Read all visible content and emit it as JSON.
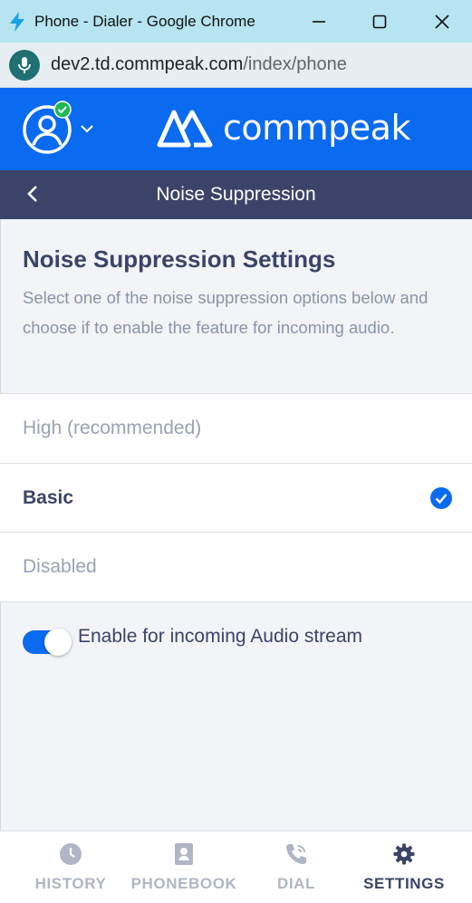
{
  "window": {
    "title": "Phone - Dialer - Google Chrome",
    "url_domain": "dev2.td.commpeak.com",
    "url_path": "/index/phone"
  },
  "header": {
    "logo_text": "commpeak",
    "brand_color": "#0a6af0",
    "status": "online"
  },
  "subheader": {
    "title": "Noise Suppression"
  },
  "settings": {
    "heading": "Noise Suppression Settings",
    "description": "Select one of the noise suppression options below and choose if to enable the feature for incoming audio.",
    "options": [
      {
        "label": "High (recommended)",
        "selected": false
      },
      {
        "label": "Basic",
        "selected": true
      },
      {
        "label": "Disabled",
        "selected": false
      }
    ],
    "toggle": {
      "label": "Enable for incoming Audio stream",
      "enabled": true
    }
  },
  "nav": {
    "items": [
      {
        "label": "HISTORY",
        "icon": "clock-icon",
        "active": false
      },
      {
        "label": "PHONEBOOK",
        "icon": "contact-book-icon",
        "active": false
      },
      {
        "label": "DIAL",
        "icon": "phone-call-icon",
        "active": false
      },
      {
        "label": "SETTINGS",
        "icon": "gear-icon",
        "active": true
      }
    ]
  }
}
